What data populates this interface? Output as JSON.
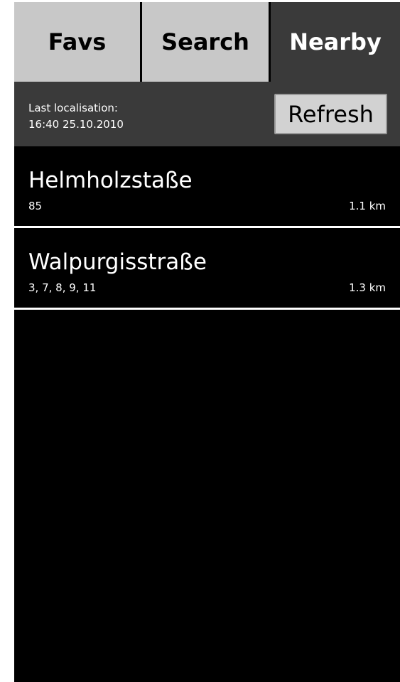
{
  "tabs": [
    {
      "label": "Favs",
      "active": false
    },
    {
      "label": "Search",
      "active": false
    },
    {
      "label": "Nearby",
      "active": true
    }
  ],
  "status": {
    "last_localisation_label": "Last  localisation:",
    "last_localisation_time": "16:40 25.10.2010",
    "refresh_label": "Refresh"
  },
  "stops": [
    {
      "name": "Helmholzstaße",
      "lines": "85",
      "distance": "1.1 km"
    },
    {
      "name": "Walpurgisstraße",
      "lines": "3, 7, 8, 9, 11",
      "distance": "1.3 km"
    }
  ],
  "colors": {
    "tab_inactive": "#c8c8c8",
    "tab_active": "#3a3a3a",
    "statusbar": "#3a3a3a",
    "list_background": "#000000",
    "separator": "#ffffff"
  }
}
